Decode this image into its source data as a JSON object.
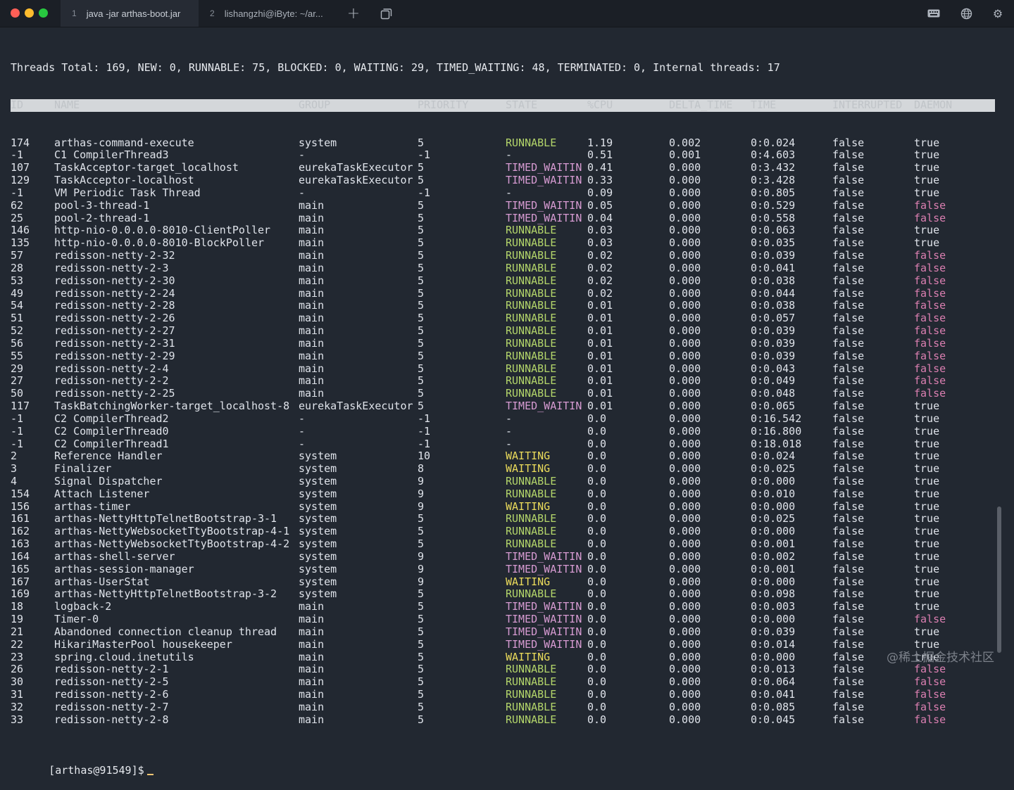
{
  "tabs": [
    {
      "num": "1",
      "label": "java -jar arthas-boot.jar",
      "active": true
    },
    {
      "num": "2",
      "label": "lishangzhi@iByte: ~/ar...",
      "active": false
    }
  ],
  "summary": "Threads Total: 169, NEW: 0, RUNNABLE: 75, BLOCKED: 0, WAITING: 29, TIMED_WAITING: 48, TERMINATED: 0, Internal threads: 17",
  "columns": [
    "ID",
    "NAME",
    "GROUP",
    "PRIORITY",
    "STATE",
    "%CPU",
    "DELTA_TIME",
    "TIME",
    "INTERRUPTED",
    "DAEMON"
  ],
  "rows": [
    [
      "174",
      "arthas-command-execute",
      "system",
      "5",
      "RUNNABLE",
      "1.19",
      "0.002",
      "0:0.024",
      "false",
      "true"
    ],
    [
      "-1",
      "C1 CompilerThread3",
      "-",
      "-1",
      "-",
      "0.51",
      "0.001",
      "0:4.603",
      "false",
      "true"
    ],
    [
      "107",
      "TaskAcceptor-target_localhost",
      "eurekaTaskExecutor",
      "5",
      "TIMED_WAITIN",
      "0.41",
      "0.000",
      "0:3.432",
      "false",
      "true"
    ],
    [
      "129",
      "TaskAcceptor-localhost",
      "eurekaTaskExecutor",
      "5",
      "TIMED_WAITIN",
      "0.33",
      "0.000",
      "0:3.428",
      "false",
      "true"
    ],
    [
      "-1",
      "VM Periodic Task Thread",
      "-",
      "-1",
      "-",
      "0.09",
      "0.000",
      "0:0.805",
      "false",
      "true"
    ],
    [
      "62",
      "pool-3-thread-1",
      "main",
      "5",
      "TIMED_WAITIN",
      "0.05",
      "0.000",
      "0:0.529",
      "false",
      "false"
    ],
    [
      "25",
      "pool-2-thread-1",
      "main",
      "5",
      "TIMED_WAITIN",
      "0.04",
      "0.000",
      "0:0.558",
      "false",
      "false"
    ],
    [
      "146",
      "http-nio-0.0.0.0-8010-ClientPoller",
      "main",
      "5",
      "RUNNABLE",
      "0.03",
      "0.000",
      "0:0.063",
      "false",
      "true"
    ],
    [
      "135",
      "http-nio-0.0.0.0-8010-BlockPoller",
      "main",
      "5",
      "RUNNABLE",
      "0.03",
      "0.000",
      "0:0.035",
      "false",
      "true"
    ],
    [
      "57",
      "redisson-netty-2-32",
      "main",
      "5",
      "RUNNABLE",
      "0.02",
      "0.000",
      "0:0.039",
      "false",
      "false"
    ],
    [
      "28",
      "redisson-netty-2-3",
      "main",
      "5",
      "RUNNABLE",
      "0.02",
      "0.000",
      "0:0.041",
      "false",
      "false"
    ],
    [
      "53",
      "redisson-netty-2-30",
      "main",
      "5",
      "RUNNABLE",
      "0.02",
      "0.000",
      "0:0.038",
      "false",
      "false"
    ],
    [
      "49",
      "redisson-netty-2-24",
      "main",
      "5",
      "RUNNABLE",
      "0.02",
      "0.000",
      "0:0.044",
      "false",
      "false"
    ],
    [
      "54",
      "redisson-netty-2-28",
      "main",
      "5",
      "RUNNABLE",
      "0.01",
      "0.000",
      "0:0.038",
      "false",
      "false"
    ],
    [
      "51",
      "redisson-netty-2-26",
      "main",
      "5",
      "RUNNABLE",
      "0.01",
      "0.000",
      "0:0.057",
      "false",
      "false"
    ],
    [
      "52",
      "redisson-netty-2-27",
      "main",
      "5",
      "RUNNABLE",
      "0.01",
      "0.000",
      "0:0.039",
      "false",
      "false"
    ],
    [
      "56",
      "redisson-netty-2-31",
      "main",
      "5",
      "RUNNABLE",
      "0.01",
      "0.000",
      "0:0.039",
      "false",
      "false"
    ],
    [
      "55",
      "redisson-netty-2-29",
      "main",
      "5",
      "RUNNABLE",
      "0.01",
      "0.000",
      "0:0.039",
      "false",
      "false"
    ],
    [
      "29",
      "redisson-netty-2-4",
      "main",
      "5",
      "RUNNABLE",
      "0.01",
      "0.000",
      "0:0.043",
      "false",
      "false"
    ],
    [
      "27",
      "redisson-netty-2-2",
      "main",
      "5",
      "RUNNABLE",
      "0.01",
      "0.000",
      "0:0.049",
      "false",
      "false"
    ],
    [
      "50",
      "redisson-netty-2-25",
      "main",
      "5",
      "RUNNABLE",
      "0.01",
      "0.000",
      "0:0.048",
      "false",
      "false"
    ],
    [
      "117",
      "TaskBatchingWorker-target_localhost-8",
      "eurekaTaskExecutor",
      "5",
      "TIMED_WAITIN",
      "0.01",
      "0.000",
      "0:0.065",
      "false",
      "true"
    ],
    [
      "-1",
      "C2 CompilerThread2",
      "-",
      "-1",
      "-",
      "0.0",
      "0.000",
      "0:16.542",
      "false",
      "true"
    ],
    [
      "-1",
      "C2 CompilerThread0",
      "-",
      "-1",
      "-",
      "0.0",
      "0.000",
      "0:16.800",
      "false",
      "true"
    ],
    [
      "-1",
      "C2 CompilerThread1",
      "-",
      "-1",
      "-",
      "0.0",
      "0.000",
      "0:18.018",
      "false",
      "true"
    ],
    [
      "2",
      "Reference Handler",
      "system",
      "10",
      "WAITING",
      "0.0",
      "0.000",
      "0:0.024",
      "false",
      "true"
    ],
    [
      "3",
      "Finalizer",
      "system",
      "8",
      "WAITING",
      "0.0",
      "0.000",
      "0:0.025",
      "false",
      "true"
    ],
    [
      "4",
      "Signal Dispatcher",
      "system",
      "9",
      "RUNNABLE",
      "0.0",
      "0.000",
      "0:0.000",
      "false",
      "true"
    ],
    [
      "154",
      "Attach Listener",
      "system",
      "9",
      "RUNNABLE",
      "0.0",
      "0.000",
      "0:0.010",
      "false",
      "true"
    ],
    [
      "156",
      "arthas-timer",
      "system",
      "9",
      "WAITING",
      "0.0",
      "0.000",
      "0:0.000",
      "false",
      "true"
    ],
    [
      "161",
      "arthas-NettyHttpTelnetBootstrap-3-1",
      "system",
      "5",
      "RUNNABLE",
      "0.0",
      "0.000",
      "0:0.025",
      "false",
      "true"
    ],
    [
      "162",
      "arthas-NettyWebsocketTtyBootstrap-4-1",
      "system",
      "5",
      "RUNNABLE",
      "0.0",
      "0.000",
      "0:0.000",
      "false",
      "true"
    ],
    [
      "163",
      "arthas-NettyWebsocketTtyBootstrap-4-2",
      "system",
      "5",
      "RUNNABLE",
      "0.0",
      "0.000",
      "0:0.001",
      "false",
      "true"
    ],
    [
      "164",
      "arthas-shell-server",
      "system",
      "9",
      "TIMED_WAITIN",
      "0.0",
      "0.000",
      "0:0.002",
      "false",
      "true"
    ],
    [
      "165",
      "arthas-session-manager",
      "system",
      "9",
      "TIMED_WAITIN",
      "0.0",
      "0.000",
      "0:0.001",
      "false",
      "true"
    ],
    [
      "167",
      "arthas-UserStat",
      "system",
      "9",
      "WAITING",
      "0.0",
      "0.000",
      "0:0.000",
      "false",
      "true"
    ],
    [
      "169",
      "arthas-NettyHttpTelnetBootstrap-3-2",
      "system",
      "5",
      "RUNNABLE",
      "0.0",
      "0.000",
      "0:0.098",
      "false",
      "true"
    ],
    [
      "18",
      "logback-2",
      "main",
      "5",
      "TIMED_WAITIN",
      "0.0",
      "0.000",
      "0:0.003",
      "false",
      "true"
    ],
    [
      "19",
      "Timer-0",
      "main",
      "5",
      "TIMED_WAITIN",
      "0.0",
      "0.000",
      "0:0.000",
      "false",
      "false"
    ],
    [
      "21",
      "Abandoned connection cleanup thread",
      "main",
      "5",
      "TIMED_WAITIN",
      "0.0",
      "0.000",
      "0:0.039",
      "false",
      "true"
    ],
    [
      "22",
      "HikariMasterPool housekeeper",
      "main",
      "5",
      "TIMED_WAITIN",
      "0.0",
      "0.000",
      "0:0.014",
      "false",
      "true"
    ],
    [
      "23",
      "spring.cloud.inetutils",
      "main",
      "5",
      "WAITING",
      "0.0",
      "0.000",
      "0:0.000",
      "false",
      "true"
    ],
    [
      "26",
      "redisson-netty-2-1",
      "main",
      "5",
      "RUNNABLE",
      "0.0",
      "0.000",
      "0:0.013",
      "false",
      "false"
    ],
    [
      "30",
      "redisson-netty-2-5",
      "main",
      "5",
      "RUNNABLE",
      "0.0",
      "0.000",
      "0:0.064",
      "false",
      "false"
    ],
    [
      "31",
      "redisson-netty-2-6",
      "main",
      "5",
      "RUNNABLE",
      "0.0",
      "0.000",
      "0:0.041",
      "false",
      "false"
    ],
    [
      "32",
      "redisson-netty-2-7",
      "main",
      "5",
      "RUNNABLE",
      "0.0",
      "0.000",
      "0:0.085",
      "false",
      "false"
    ],
    [
      "33",
      "redisson-netty-2-8",
      "main",
      "5",
      "RUNNABLE",
      "0.0",
      "0.000",
      "0:0.045",
      "false",
      "false"
    ]
  ],
  "prompt": "[arthas@91549]$",
  "watermark": "@稀土掘金技术社区",
  "icons": {
    "plus": "plus-icon",
    "new_window": "new-window-icon",
    "keyboard": "keyboard-icon",
    "globe": "globe-icon",
    "gear": "gear-icon"
  },
  "colors": {
    "runnable": "#b3d56a",
    "timed_waiting": "#d79bd2",
    "waiting": "#ecdc5b",
    "daemon_false": "#db7fb1",
    "background": "#222831"
  }
}
